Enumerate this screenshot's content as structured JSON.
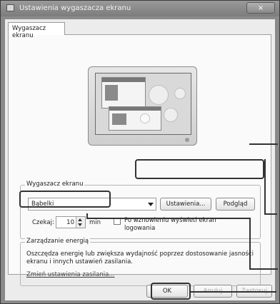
{
  "window": {
    "title": "Ustawienia wygaszacza ekranu",
    "close_glyph": "×"
  },
  "tab": {
    "label": "Wygaszacz ekranu"
  },
  "screensaver": {
    "legend": "Wygaszacz ekranu",
    "selected": "Bąbelki",
    "settings_button": "Ustawienia...",
    "preview_button": "Podgląd",
    "wait_label": "Czekaj:",
    "wait_value": "10",
    "wait_unit": "min",
    "resume_checkbox_label": "Po wznowieniu wyświetl ekran logowania",
    "resume_checked": false
  },
  "energy": {
    "legend": "Zarządzanie energią",
    "description": "Oszczędza energię lub zwiększa wydajność poprzez dostosowanie jasności ekranu i innych ustawień zasilania.",
    "link": "Zmień ustawienia zasilania..."
  },
  "footer": {
    "ok": "OK",
    "cancel": "Anuluj",
    "apply": "Zastosuj"
  },
  "icons": {
    "window_icon": "screensaver-window-icon",
    "dropdown": "chevron-down-icon",
    "spinner": "spinner-arrows-icon"
  }
}
